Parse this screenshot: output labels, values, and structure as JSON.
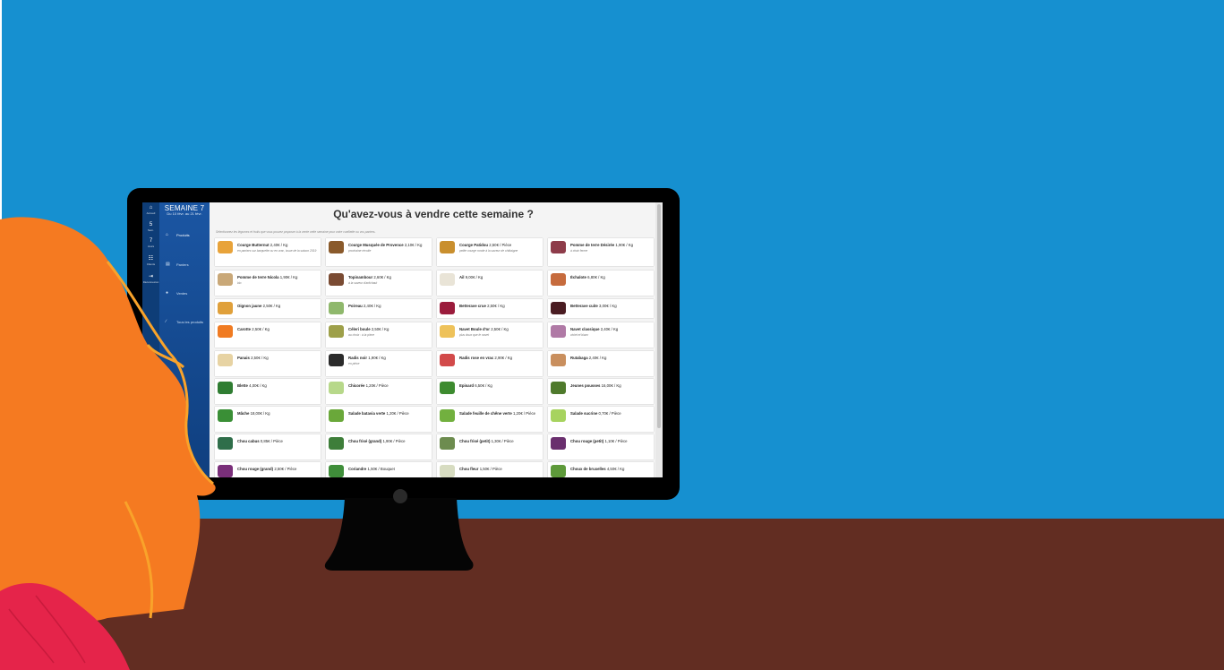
{
  "colors": {
    "wall": "#1690d0",
    "floor": "#622d22",
    "hair": "#f57a21",
    "hair_light": "#f9a32a",
    "shirt": "#e5244a"
  },
  "app": {
    "week_title": "SEMAINE 7",
    "week_dates": "Du 10 févr. au 21 févr.",
    "rail": [
      {
        "icon": "home-icon",
        "glyph": "⌂",
        "label": "Accueil"
      },
      {
        "icon": "week-icon",
        "glyph": "5",
        "label": "Sem."
      },
      {
        "icon": "day-icon",
        "glyph": "7",
        "label": "Jours"
      },
      {
        "icon": "users-icon",
        "glyph": "☷",
        "label": "Clients"
      },
      {
        "icon": "logout-icon",
        "glyph": "⇥",
        "label": "Déconnexion"
      }
    ],
    "nav": [
      {
        "icon": "home-icon",
        "glyph": "⌂",
        "label": "Produits",
        "active": true
      },
      {
        "icon": "basket-icon",
        "glyph": "▤",
        "label": "Paniers",
        "active": false
      },
      {
        "icon": "pin-icon",
        "glyph": "●",
        "label": "Ventes",
        "active": false
      },
      {
        "icon": "link-icon",
        "glyph": "∕",
        "label": "Tous les produits",
        "active": false
      }
    ],
    "heading": "Qu'avez-vous à vendre cette semaine ?",
    "subtitle": "Sélectionnez les légumes et fruits que vous pouvez proposer à la vente cette semaine pour votre cueillette ou vos paniers.",
    "products": [
      {
        "name": "Courge Butternut",
        "price": "2,40€ / Kg",
        "desc": "en paniers sur barquette ou en vrac, issue de la saison 2019",
        "color": "#e8a33a"
      },
      {
        "name": "Courge Musquée de Provence",
        "price": "2,10€ / Kg",
        "desc": "prochaine récolte",
        "color": "#8a5a2b"
      },
      {
        "name": "Courge Patidou",
        "price": "2,50€ / Pièce",
        "desc": "petite courge ronde à la saveur de châtaigne",
        "color": "#c98f2e"
      },
      {
        "name": "Pomme de terre Désirée",
        "price": "1,90€ / Kg",
        "desc": "à chair ferme",
        "color": "#8e3c4a"
      },
      {
        "name": "Pomme de terre Nicola",
        "price": "1,90€ / Kg",
        "desc": "bio",
        "color": "#c9a878"
      },
      {
        "name": "Topinambour",
        "price": "2,60€ / Kg",
        "desc": "à la saveur d'artichaut",
        "color": "#7a4b33"
      },
      {
        "name": "Ail",
        "price": "9,00€ / Kg",
        "desc": "",
        "color": "#e9e4d7"
      },
      {
        "name": "Échalote",
        "price": "6,80€ / Kg",
        "desc": "",
        "color": "#c66b3d"
      },
      {
        "name": "Oignon jaune",
        "price": "2,50€ / Kg",
        "desc": "",
        "color": "#e0a03a"
      },
      {
        "name": "Poireau",
        "price": "2,40€ / Kg",
        "desc": "",
        "color": "#8fb86c"
      },
      {
        "name": "Betterave crue",
        "price": "2,50€ / Kg",
        "desc": "",
        "color": "#9b1c3c"
      },
      {
        "name": "Betterave cuite",
        "price": "3,00€ / Kg",
        "desc": "",
        "color": "#4a1c22"
      },
      {
        "name": "Carotte",
        "price": "2,50€ / Kg",
        "desc": "",
        "color": "#f07b22"
      },
      {
        "name": "Céleri boule",
        "price": "2,50€ / Kg",
        "desc": "au choix : à la pièce",
        "color": "#9ea04a"
      },
      {
        "name": "Navet Boule d'or",
        "price": "2,50€ / Kg",
        "desc": "plus doux que le navet",
        "color": "#eec25a"
      },
      {
        "name": "Navet classique",
        "price": "2,40€ / Kg",
        "desc": "violet et blanc",
        "color": "#b07aa6"
      },
      {
        "name": "Panais",
        "price": "2,50€ / Kg",
        "desc": "",
        "color": "#e7d3a3"
      },
      {
        "name": "Radis noir",
        "price": "1,90€ / Kg",
        "desc": "en pièce",
        "color": "#2b2b2b"
      },
      {
        "name": "Radis rose en vrac",
        "price": "2,90€ / Kg",
        "desc": "",
        "color": "#d24a4a"
      },
      {
        "name": "Rutabaga",
        "price": "2,40€ / Kg",
        "desc": "",
        "color": "#c98f5e"
      },
      {
        "name": "Blette",
        "price": "4,00€ / Kg",
        "desc": "",
        "color": "#2f7d32"
      },
      {
        "name": "Chicorée",
        "price": "1,20€ / Pièce",
        "desc": "",
        "color": "#b7d88a"
      },
      {
        "name": "Epinard",
        "price": "6,50€ / Kg",
        "desc": "",
        "color": "#3d8b2f"
      },
      {
        "name": "Jeunes pousses",
        "price": "16,00€ / Kg",
        "desc": "",
        "color": "#4f7a2c"
      },
      {
        "name": "Mâche",
        "price": "18,00€ / Kg",
        "desc": "",
        "color": "#3a8f36"
      },
      {
        "name": "Salade batavia verte",
        "price": "1,20€ / Pièce",
        "desc": "",
        "color": "#6aa83a"
      },
      {
        "name": "Salade feuille de chêne verte",
        "price": "1,20€ / Pièce",
        "desc": "",
        "color": "#72b03f"
      },
      {
        "name": "Salade sucrine",
        "price": "0,70€ / Pièce",
        "desc": "",
        "color": "#a7d35f"
      },
      {
        "name": "Chou cabus",
        "price": "0,85€ / Pièce",
        "desc": "",
        "color": "#2f6e4a"
      },
      {
        "name": "Chou frisé (grand)",
        "price": "1,90€ / Pièce",
        "desc": "",
        "color": "#3e7e3a"
      },
      {
        "name": "Chou frisé (petit)",
        "price": "1,30€ / Pièce",
        "desc": "",
        "color": "#6d8c4f"
      },
      {
        "name": "Chou rouge (petit)",
        "price": "1,10€ / Pièce",
        "desc": "",
        "color": "#6a2f6e"
      },
      {
        "name": "Chou rouge (grand)",
        "price": "2,50€ / Pièce",
        "desc": "",
        "color": "#7a2f7a"
      },
      {
        "name": "Coriandre",
        "price": "1,50€ / Bouquet",
        "desc": "",
        "color": "#3f8e3a"
      },
      {
        "name": "Chou fleur",
        "price": "1,50€ / Pièce",
        "desc": "",
        "color": "#d7dcc1"
      },
      {
        "name": "Choux de bruxelles",
        "price": "4,50€ / Kg",
        "desc": "",
        "color": "#5e9a3a"
      }
    ]
  }
}
